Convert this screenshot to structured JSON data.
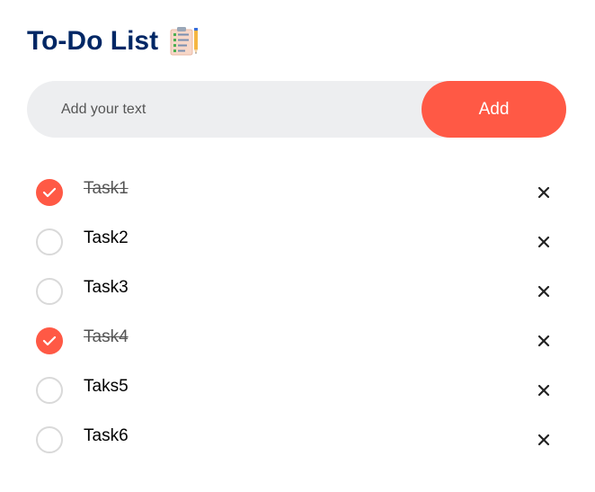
{
  "app": {
    "title": "To-Do List",
    "title_icon": "notepad-icon"
  },
  "input": {
    "placeholder": "Add your text",
    "value": "",
    "add_label": "Add"
  },
  "tasks": [
    {
      "label": "Task1",
      "checked": true
    },
    {
      "label": "Task2",
      "checked": false
    },
    {
      "label": "Task3",
      "checked": false
    },
    {
      "label": "Task4",
      "checked": true
    },
    {
      "label": "Taks5",
      "checked": false
    },
    {
      "label": "Task6",
      "checked": false
    }
  ],
  "colors": {
    "title": "#002765",
    "accent": "#ff5945",
    "input_bg": "#edeef0",
    "unchecked_border": "#d9d9d9"
  },
  "icons": {
    "check": "check-icon",
    "delete": "close-icon"
  }
}
